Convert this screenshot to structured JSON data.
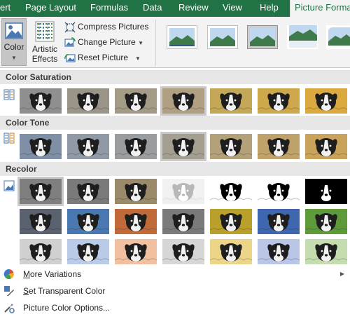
{
  "tabs": [
    "ert",
    "Page Layout",
    "Formulas",
    "Data",
    "Review",
    "View",
    "Help",
    "Picture Format"
  ],
  "ribbon": {
    "color_label": "Color",
    "artistic_label_1": "Artistic",
    "artistic_label_2": "Effects",
    "compress": "Compress Pictures",
    "change": "Change Picture",
    "reset": "Reset Picture",
    "picture_style_names": [
      "simple-frame-style",
      "soft-edge-style",
      "drop-shadow-style",
      "reflected-style",
      "rounded-style"
    ]
  },
  "sections": {
    "saturation": "Color Saturation",
    "tone": "Color Tone",
    "recolor": "Recolor"
  },
  "saturation_tints": [
    "#8f8f8f",
    "#9a9588",
    "#a49b86",
    "#b09f80",
    "#c4a757",
    "#cfa84c",
    "#dba93f"
  ],
  "tone_tints": [
    "#7f8fa6",
    "#8f9aa6",
    "#9a9da0",
    "#a59f92",
    "#b3a17a",
    "#bfa26a",
    "#c9a35a"
  ],
  "recolor_rows": [
    [
      "#7f7f7f",
      "#7a7a7a",
      "#9a8a6a",
      "#e0e0e0",
      "#ffffff",
      "#ffffff",
      "#000000"
    ],
    [
      "#5a6270",
      "#4a78b0",
      "#c06a3a",
      "#7a7a7a",
      "#b8a02a",
      "#3f67b0",
      "#5f9a3a"
    ],
    [
      "#d0d0d0",
      "#b9cbe6",
      "#f0c0a0",
      "#d6d6d6",
      "#ecd488",
      "#b9c6e6",
      "#c4dcb0"
    ]
  ],
  "menu": {
    "more_variations_pre": "M",
    "more_variations_rest": "ore Variations",
    "set_transparent_pre": "S",
    "set_transparent_rest": "et Transparent Color",
    "color_options_pre": "",
    "color_options_rest": "Picture Color Options..."
  },
  "colors": {
    "tab_green": "#217346",
    "section_bg": "#e6e6e6"
  }
}
